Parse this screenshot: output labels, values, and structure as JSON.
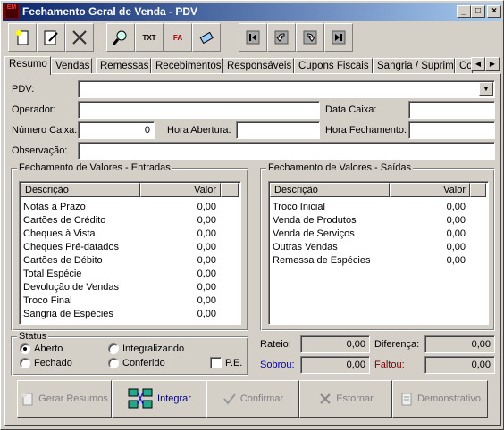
{
  "window": {
    "title": "Fechamento Geral de Venda - PDV",
    "app_icon_text": "EM"
  },
  "tabs": [
    "Resumo",
    "Vendas",
    "Remessas",
    "Recebimentos",
    "Responsáveis",
    "Cupons Fiscais",
    "Sangria / Suprim",
    "Co"
  ],
  "form": {
    "pdv_label": "PDV:",
    "pdv_value": "",
    "operador_label": "Operador:",
    "operador_value": "",
    "data_caixa_label": "Data Caixa:",
    "data_caixa_value": "",
    "numero_caixa_label": "Número Caixa:",
    "numero_caixa_value": "0",
    "hora_abertura_label": "Hora Abertura:",
    "hora_abertura_value": "",
    "hora_fechamento_label": "Hora Fechamento:",
    "hora_fechamento_value": "",
    "observacao_label": "Observação:",
    "observacao_value": ""
  },
  "entradas": {
    "title": "Fechamento de Valores - Entradas",
    "col_desc": "Descrição",
    "col_valor": "Valor",
    "rows": [
      {
        "desc": "Notas a Prazo",
        "valor": "0,00"
      },
      {
        "desc": "Cartões de Crédito",
        "valor": "0,00"
      },
      {
        "desc": "Cheques à Vista",
        "valor": "0,00"
      },
      {
        "desc": "Cheques Pré-datados",
        "valor": "0,00"
      },
      {
        "desc": "Cartões de Débito",
        "valor": "0,00"
      },
      {
        "desc": "Total Espécie",
        "valor": "0,00"
      },
      {
        "desc": "Devolução de Vendas",
        "valor": "0,00"
      },
      {
        "desc": "Troco Final",
        "valor": "0,00"
      },
      {
        "desc": "Sangria de Espécies",
        "valor": "0,00"
      }
    ]
  },
  "saidas": {
    "title": "Fechamento de Valores - Saídas",
    "col_desc": "Descrição",
    "col_valor": "Valor",
    "rows": [
      {
        "desc": "Troco Inicial",
        "valor": "0,00"
      },
      {
        "desc": "Venda de Produtos",
        "valor": "0,00"
      },
      {
        "desc": "Venda de Serviços",
        "valor": "0,00"
      },
      {
        "desc": "Outras Vendas",
        "valor": "0,00"
      },
      {
        "desc": "Remessa de Espécies",
        "valor": "0,00"
      }
    ]
  },
  "status": {
    "title": "Status",
    "aberto": "Aberto",
    "fechado": "Fechado",
    "integralizando": "Integralizando",
    "conferido": "Conferido",
    "pe": "P.E.",
    "selected": "aberto"
  },
  "totals": {
    "rateio_label": "Rateio:",
    "rateio_value": "0,00",
    "diferenca_label": "Diferença:",
    "diferenca_value": "0,00",
    "sobrou_label": "Sobrou:",
    "sobrou_value": "0,00",
    "faltou_label": "Faltou:",
    "faltou_value": "0,00",
    "sobrou_color": "#0000c0",
    "faltou_color": "#800000"
  },
  "buttons": {
    "gerar_resumos": "Gerar Resumos",
    "integrar": "Integrar",
    "confirmar": "Confirmar",
    "estornar": "Estornar",
    "demonstrativo": "Demonstrativo"
  },
  "toolbar_icons": {
    "txt": "TXT",
    "fa": "FA"
  }
}
